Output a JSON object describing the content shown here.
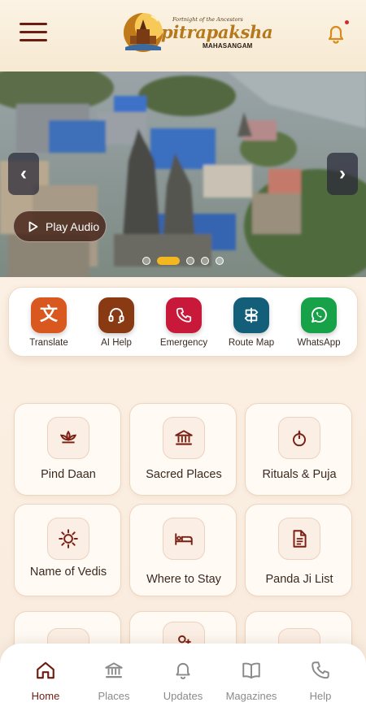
{
  "header": {
    "logo_tagline": "Fortnight of the Ancestors",
    "logo_word": "pitrapaksha",
    "logo_sub": "MAHASANGAM",
    "notification_indicator": true
  },
  "hero": {
    "play_audio_label": "Play Audio",
    "prev_glyph": "‹",
    "next_glyph": "›",
    "slide_count": 5,
    "active_slide": 2
  },
  "quick_actions": [
    {
      "label": "Translate",
      "icon": "translate-icon",
      "color": "#d9581f"
    },
    {
      "label": "AI Help",
      "icon": "headset-icon",
      "color": "#8a3a12"
    },
    {
      "label": "Emergency",
      "icon": "phone-icon",
      "color": "#c8193a"
    },
    {
      "label": "Route Map",
      "icon": "signpost-icon",
      "color": "#135f7a"
    },
    {
      "label": "WhatsApp",
      "icon": "whatsapp-icon",
      "color": "#17a148"
    }
  ],
  "features": [
    {
      "label": "Pind Daan",
      "icon": "lotus-icon"
    },
    {
      "label": "Sacred Places",
      "icon": "temple-icon"
    },
    {
      "label": "Rituals & Puja",
      "icon": "diya-icon"
    },
    {
      "label": "Name of Vedis",
      "icon": "sun-icon"
    },
    {
      "label": "Where to Stay",
      "icon": "bed-icon"
    },
    {
      "label": "Panda Ji List",
      "icon": "document-icon"
    }
  ],
  "bottom_nav": [
    {
      "label": "Home",
      "icon": "home-icon",
      "active": true
    },
    {
      "label": "Places",
      "icon": "landmark-icon",
      "active": false
    },
    {
      "label": "Updates",
      "icon": "bell-icon",
      "active": false
    },
    {
      "label": "Magazines",
      "icon": "book-icon",
      "active": false
    },
    {
      "label": "Help",
      "icon": "phone-icon",
      "active": false
    }
  ],
  "colors": {
    "primary": "#6b1d12",
    "accent_gold": "#f3b820",
    "background": "#fbf3e8"
  }
}
